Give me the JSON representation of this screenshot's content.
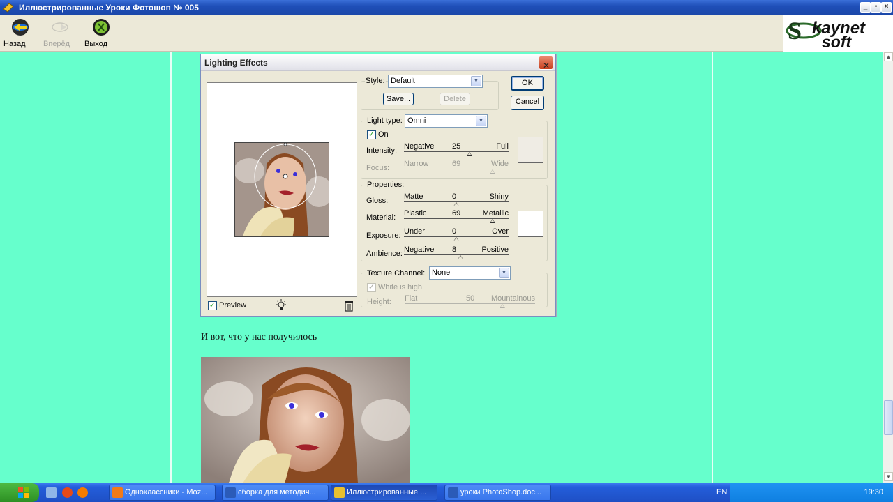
{
  "window": {
    "title": "Иллюстрированные Уроки Фотошоп № 005"
  },
  "toolbar": {
    "back_label": "Назад",
    "forward_label": "Вперёд",
    "exit_label": "Выход"
  },
  "logo": {
    "line1": "kaynet",
    "line2": "soft",
    "initial": "S"
  },
  "content": {
    "result_text": "И вот, что у нас получилось"
  },
  "dialog": {
    "title": "Lighting Effects",
    "ok_label": "OK",
    "cancel_label": "Cancel",
    "style_label": "Style:",
    "style_value": "Default",
    "save_label": "Save...",
    "delete_label": "Delete",
    "light_type_label": "Light type:",
    "light_type_value": "Omni",
    "on_label": "On",
    "on_checked": true,
    "intensity": {
      "label": "Intensity:",
      "low": "Negative",
      "high": "Full",
      "value": "25",
      "percent": 25
    },
    "focus": {
      "label": "Focus:",
      "low": "Narrow",
      "high": "Wide",
      "value": "69",
      "percent": 69,
      "disabled": true
    },
    "light_color": "#efece4",
    "properties_label": "Properties:",
    "gloss": {
      "label": "Gloss:",
      "low": "Matte",
      "high": "Shiny",
      "value": "0",
      "percent": 0
    },
    "material": {
      "label": "Material:",
      "low": "Plastic",
      "high": "Metallic",
      "value": "69",
      "percent": 69
    },
    "exposure": {
      "label": "Exposure:",
      "low": "Under",
      "high": "Over",
      "value": "0",
      "percent": 0
    },
    "ambience": {
      "label": "Ambience:",
      "low": "Negative",
      "high": "Positive",
      "value": "8",
      "percent": 8
    },
    "property_color": "#ffffff",
    "texture_label": "Texture Channel:",
    "texture_value": "None",
    "white_high_label": "White is high",
    "height": {
      "label": "Height:",
      "low": "Flat",
      "high": "Mountainous",
      "value": "50",
      "percent": 50
    },
    "preview_label": "Preview",
    "preview_checked": true
  },
  "taskbar": {
    "lang": "EN",
    "clock": "19:30",
    "tasks": [
      {
        "label": "Одноклассники - Moz...",
        "color": "#f07a1a"
      },
      {
        "label": "сборка для методич...",
        "color": "#2b5bb8"
      },
      {
        "label": "Иллюстрированные ...",
        "color": "#e8c030"
      },
      {
        "label": "уроки PhotoShop.doc...",
        "color": "#2b5bb8"
      }
    ]
  },
  "icons": [
    "app-icon",
    "back-icon",
    "forward-icon",
    "exit-icon",
    "lightbulb-icon",
    "trash-icon",
    "close-icon",
    "start-icon"
  ]
}
